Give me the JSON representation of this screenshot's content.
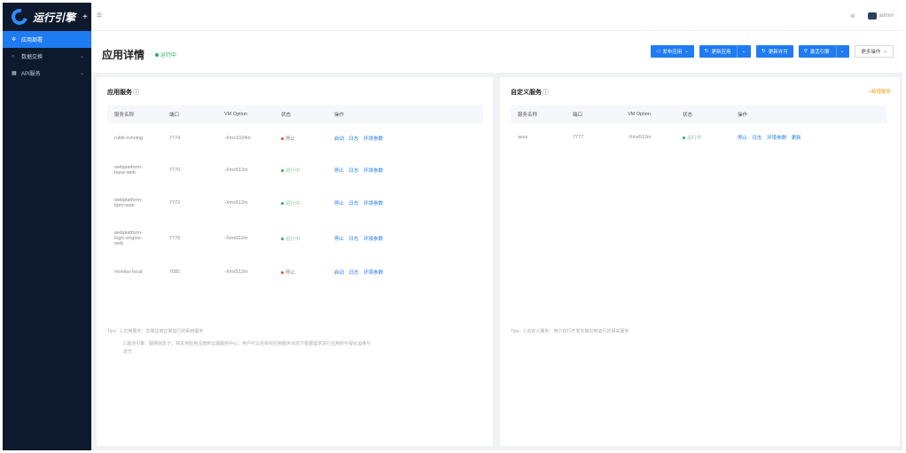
{
  "brand": {
    "name": "运行引擎",
    "plus": "+"
  },
  "sidebar": {
    "items": [
      {
        "icon": "✲",
        "label": "应用部署",
        "active": true
      },
      {
        "icon": "○",
        "label": "数据交换",
        "chevron": "⌄"
      },
      {
        "icon": "▦",
        "label": "API服务",
        "chevron": "⌄"
      }
    ]
  },
  "topbar": {
    "menu_icon": "≡",
    "settings_icon": "⚙",
    "user": "admin"
  },
  "page": {
    "title": "应用详情",
    "status": "运行中"
  },
  "toolbar": {
    "publish": "发布应用",
    "update": "更新应用",
    "update_license": "更新许可",
    "activate_engine": "激活引擎",
    "more": "更多操作",
    "dropdown": "⌄"
  },
  "app_services": {
    "title": "应用服务",
    "info_icon": "ⓘ",
    "columns": [
      "服务名称",
      "端口",
      "VM Option",
      "状态",
      "操作"
    ],
    "rows": [
      {
        "name": [
          "rubik-running"
        ],
        "port": "7774",
        "vm": "-Xmx1024m",
        "status": "停止",
        "state": "stop",
        "ops": [
          "启动",
          "日志",
          "环境参数"
        ]
      },
      {
        "name": [
          "webplatform-",
          "base-web"
        ],
        "port": "7770",
        "vm": "-Xmx512m",
        "status": "运行中",
        "state": "run",
        "ops": [
          "停止",
          "日志",
          "环境参数"
        ]
      },
      {
        "name": [
          "webplatform-",
          "bpm-web"
        ],
        "port": "7772",
        "vm": "-Xmx512m",
        "status": "运行中",
        "state": "run",
        "ops": [
          "停止",
          "日志",
          "环境参数"
        ]
      },
      {
        "name": [
          "webplatform-",
          "logic-engine-",
          "web"
        ],
        "port": "7776",
        "vm": "-Xmx512m",
        "status": "运行中",
        "state": "run",
        "ops": [
          "停止",
          "日志",
          "环境参数"
        ]
      },
      {
        "name": [
          "monitor-local"
        ],
        "port": "7082",
        "vm": "-Xmx512m",
        "status": "停止",
        "state": "stop",
        "ops": [
          "启动",
          "日志",
          "环境参数"
        ]
      }
    ],
    "tips_1": "Tips：1.应用服务：支撑应用正常运行的系统服务",
    "tips_2": "2.激活引擎：联网状态下，将本地应用注册到云端服务中心，用户可以在购买应用服务状态下根据需求进行应用的可视化运维与",
    "tips_3": "迭代"
  },
  "custom_services": {
    "title": "自定义服务",
    "info_icon": "ⓘ",
    "add": "+新增服务",
    "columns": [
      "服务名称",
      "端口",
      "VM Option",
      "状态",
      "操作"
    ],
    "rows": [
      {
        "name": "asss",
        "port": "7777",
        "vm": "-Xmx512m",
        "status": "运行中",
        "state": "run",
        "ops": [
          "停止",
          "日志",
          "环境参数",
          "更新"
        ]
      }
    ],
    "tips": "Tips：1.自定义服务：用户自行开发支撑应用运行的相关服务"
  }
}
